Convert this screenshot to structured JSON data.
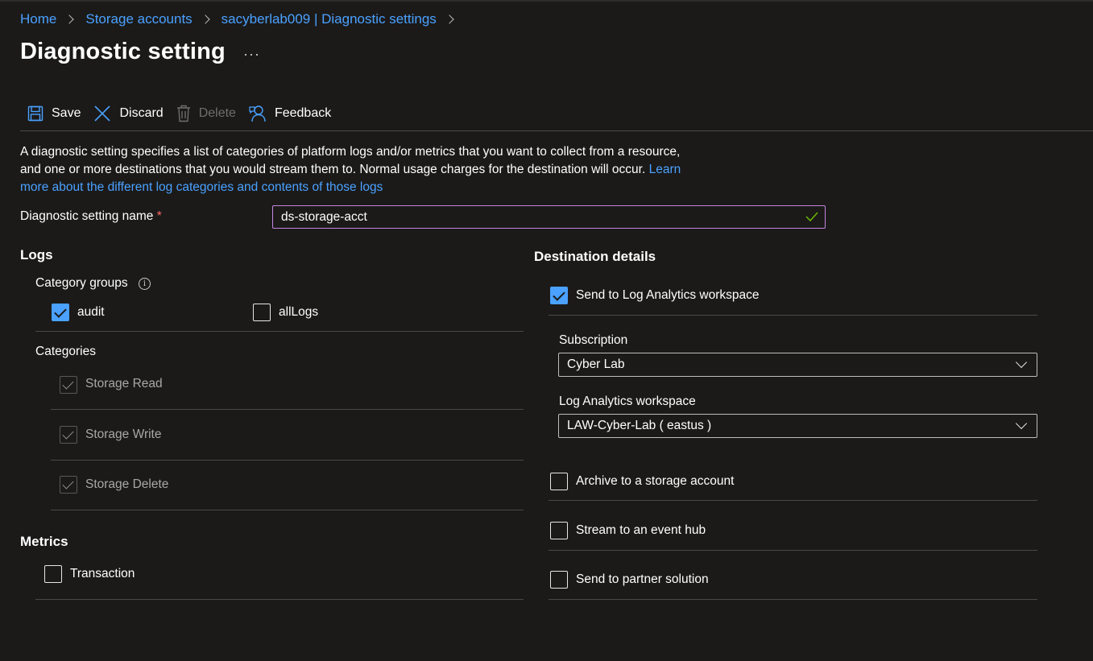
{
  "breadcrumb": [
    "Home",
    "Storage accounts",
    "sacyberlab009 | Diagnostic settings"
  ],
  "page": {
    "title": "Diagnostic setting",
    "more": "···"
  },
  "toolbar": {
    "save": "Save",
    "discard": "Discard",
    "delete": "Delete",
    "feedback": "Feedback"
  },
  "description": {
    "line1": "A diagnostic setting specifies a list of categories of platform logs and/or metrics that you want to collect from a resource,",
    "line2": "and one or more destinations that you would stream them to. Normal usage charges for the destination will occur. ",
    "link_a": "Learn",
    "link_b": "more about the different log categories and contents of those logs"
  },
  "name_field": {
    "label": "Diagnostic setting name",
    "required": "*",
    "value": "ds-storage-acct"
  },
  "logs": {
    "heading": "Logs",
    "category_groups_label": "Category groups",
    "groups": [
      {
        "label": "audit",
        "checked": true
      },
      {
        "label": "allLogs",
        "checked": false
      }
    ],
    "categories_label": "Categories",
    "categories": [
      {
        "label": "Storage Read",
        "checked": true,
        "disabled": true
      },
      {
        "label": "Storage Write",
        "checked": true,
        "disabled": true
      },
      {
        "label": "Storage Delete",
        "checked": true,
        "disabled": true
      }
    ]
  },
  "metrics": {
    "heading": "Metrics",
    "items": [
      {
        "label": "Transaction",
        "checked": false
      }
    ]
  },
  "destination": {
    "heading": "Destination details",
    "log_analytics": {
      "label": "Send to Log Analytics workspace",
      "checked": true
    },
    "subscription": {
      "label": "Subscription",
      "value": "Cyber Lab"
    },
    "workspace": {
      "label": "Log Analytics workspace",
      "value": "LAW-Cyber-Lab ( eastus )"
    },
    "archive": {
      "label": "Archive to a storage account",
      "checked": false
    },
    "event_hub": {
      "label": "Stream to an event hub",
      "checked": false
    },
    "partner": {
      "label": "Send to partner solution",
      "checked": false
    }
  },
  "colors": {
    "accent": "#4aa1ff",
    "background": "#1b1a19",
    "focus_border": "#c586e0",
    "valid": "#6bb700"
  }
}
